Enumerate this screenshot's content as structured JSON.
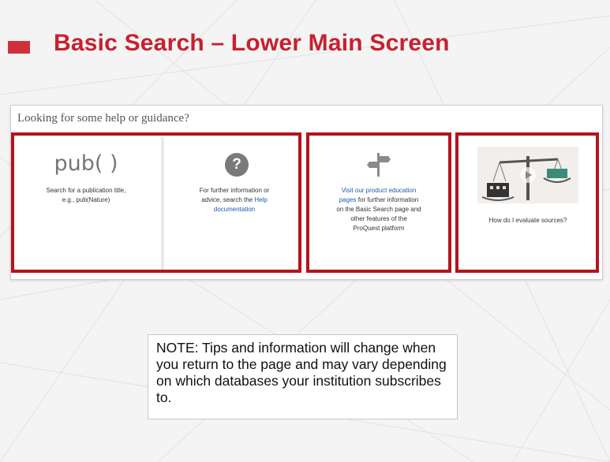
{
  "slide": {
    "title": "Basic Search – Lower Main Screen"
  },
  "panel": {
    "header": "Looking for some help or guidance?",
    "cards": [
      {
        "heading": "pub( )",
        "text_lines": [
          "Search for a publication title,",
          "e.g., pub(Nature)"
        ],
        "icon": "pub-text"
      },
      {
        "icon": "question-circle-icon",
        "text_lines": [
          "For further information or",
          "advice, search the"
        ],
        "link_part1": "Help",
        "link_part2": "documentation"
      },
      {
        "icon": "signpost-icon",
        "link_line1": "Visit our product education",
        "link_line2": "pages",
        "text_after_link": "for further information",
        "text_lines": [
          "on the Basic Search page and",
          "other features of the",
          "ProQuest platform"
        ]
      },
      {
        "icon": "scales-video-thumbnail",
        "text": "How do I evaluate sources?"
      }
    ]
  },
  "note": {
    "text": "NOTE:  Tips and information will change when you return to the page and may vary depending on which databases your institution subscribes to."
  },
  "colors": {
    "title": "#c8202e",
    "highlight_border": "#b3141e",
    "link": "#1a5bb0"
  }
}
